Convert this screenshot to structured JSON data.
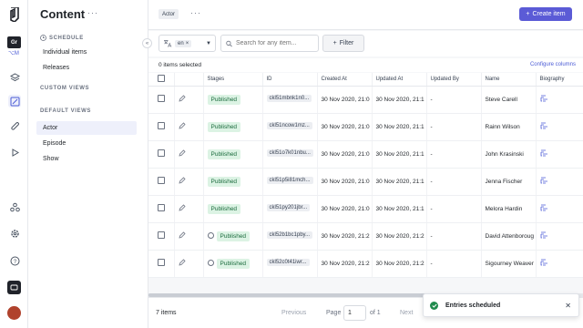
{
  "rail": {
    "workspace_initials": "Gr",
    "environment_label": "M",
    "icons": [
      "schema-icon",
      "content-icon",
      "assets-icon",
      "api-playground-icon",
      "webhooks-icon",
      "settings-icon",
      "help-icon",
      "chat-icon"
    ]
  },
  "sidebar": {
    "title": "Content",
    "schedule_section": "SCHEDULE",
    "schedule_items": [
      {
        "label": "Individual items"
      },
      {
        "label": "Releases"
      }
    ],
    "custom_views_section": "CUSTOM VIEWS",
    "default_views_section": "DEFAULT VIEWS",
    "views": [
      {
        "label": "Actor",
        "selected": true
      },
      {
        "label": "Episode",
        "selected": false
      },
      {
        "label": "Show",
        "selected": false
      }
    ]
  },
  "topbar": {
    "tag": "Actor",
    "create_label": "Create item"
  },
  "filters": {
    "locale": "en",
    "search_placeholder": "Search for any item...",
    "filter_label": "Filter"
  },
  "selection": {
    "count_text": "0 items selected",
    "configure_label": "Configure columns"
  },
  "table": {
    "headers": [
      "Stages",
      "ID",
      "Created At",
      "Updated At",
      "Updated By",
      "Name",
      "Biography"
    ],
    "rows": [
      {
        "stage": "Published",
        "scheduled": false,
        "id": "ckl51mbnk1n0...",
        "created": "30 Nov 2020, 21:0",
        "updated": "30 Nov 2020, 21:1",
        "by": "-",
        "name": "Steve Carell"
      },
      {
        "stage": "Published",
        "scheduled": false,
        "id": "ckl51ncow1mz...",
        "created": "30 Nov 2020, 21:0",
        "updated": "30 Nov 2020, 21:1",
        "by": "-",
        "name": "Rainn Wilson"
      },
      {
        "stage": "Published",
        "scheduled": false,
        "id": "ckl51o7k01nbu...",
        "created": "30 Nov 2020, 21:0",
        "updated": "30 Nov 2020, 21:1",
        "by": "-",
        "name": "John Krasinski"
      },
      {
        "stage": "Published",
        "scheduled": false,
        "id": "ckl51p5i81mch...",
        "created": "30 Nov 2020, 21:0",
        "updated": "30 Nov 2020, 21:1",
        "by": "-",
        "name": "Jenna Fischer"
      },
      {
        "stage": "Published",
        "scheduled": false,
        "id": "ckl51py201jbr...",
        "created": "30 Nov 2020, 21:0",
        "updated": "30 Nov 2020, 21:1",
        "by": "-",
        "name": "Melora Hardin"
      },
      {
        "stage": "Published",
        "scheduled": true,
        "id": "ckl52b1bc1pby...",
        "created": "30 Nov 2020, 21:2",
        "updated": "30 Nov 2020, 21:2",
        "by": "-",
        "name": "David Attenboroug"
      },
      {
        "stage": "Published",
        "scheduled": true,
        "id": "ckl52c0t41iwr...",
        "created": "30 Nov 2020, 21:2",
        "updated": "30 Nov 2020, 21:2",
        "by": "-",
        "name": "Sigourney Weaver"
      }
    ]
  },
  "footer": {
    "items_text": "7 items",
    "previous_label": "Previous",
    "page_label": "Page",
    "page_value": "1",
    "of_text": "of 1",
    "next_label": "Next"
  },
  "toast": {
    "message": "Entries scheduled"
  },
  "colors": {
    "accent": "#5b5bd6",
    "published_bg": "#dcf3e4",
    "published_text": "#1b6b3d",
    "success": "#1f8a4c"
  }
}
